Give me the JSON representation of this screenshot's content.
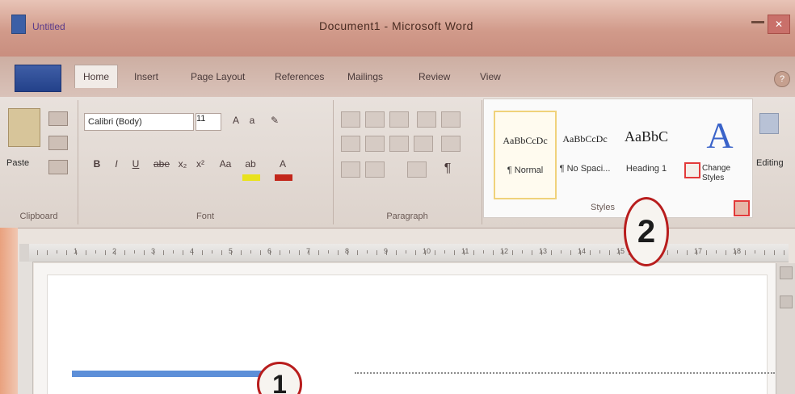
{
  "window": {
    "title": "Document1 - Microsoft Word",
    "quick_access": "Untitled",
    "close_glyph": "✕"
  },
  "tabs": [
    {
      "label": "Home",
      "active": true
    },
    {
      "label": "Insert",
      "active": false
    },
    {
      "label": "Page Layout",
      "active": false
    },
    {
      "label": "References",
      "active": false
    },
    {
      "label": "Mailings",
      "active": false
    },
    {
      "label": "Review",
      "active": false
    },
    {
      "label": "View",
      "active": false
    }
  ],
  "ribbon": {
    "clipboard": {
      "paste_label": "Paste",
      "group_label": "Clipboard"
    },
    "font": {
      "font_name": "Calibri (Body)",
      "font_size": "11",
      "group_label": "Font",
      "buttons": [
        "B",
        "I",
        "U",
        "abe",
        "x₂",
        "x²",
        "Aa",
        "A"
      ]
    },
    "paragraph": {
      "group_label": "Paragraph",
      "pilcrow": "¶"
    },
    "styles": {
      "group_label": "Styles",
      "tiles": [
        {
          "sample": "AaBbCcDc",
          "name": "¶ Normal",
          "selected": true
        },
        {
          "sample": "AaBbCcDc",
          "name": "¶ No Spaci...",
          "selected": false
        },
        {
          "sample": "AaBbC",
          "name": "Heading 1",
          "selected": false
        }
      ],
      "change_styles_label": "Change Styles",
      "change_styles_glyph": "A"
    },
    "editing": {
      "label": "Editing"
    }
  },
  "callouts": {
    "one": "1",
    "two": "2"
  },
  "ruler": {
    "numbers": [
      "1",
      "2",
      "3",
      "4",
      "5",
      "6",
      "7",
      "8",
      "9",
      "10",
      "11",
      "12",
      "13",
      "14",
      "15",
      "16",
      "17",
      "18"
    ]
  },
  "colors": {
    "accent_red": "#e23a3a",
    "callout_border": "#b81d1d",
    "selection_blue": "#5d8fd8",
    "titlebar": "#d19a8a"
  }
}
